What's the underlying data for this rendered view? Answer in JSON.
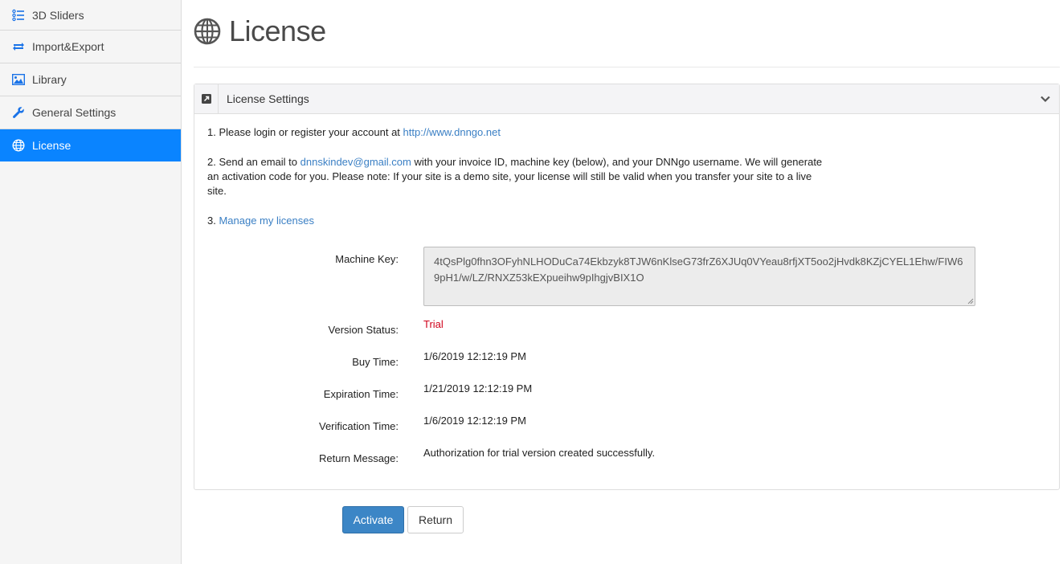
{
  "sidebar": {
    "items": [
      {
        "label": "3D Sliders",
        "icon": "list-icon"
      },
      {
        "label": "Import&Export",
        "icon": "sync-icon"
      },
      {
        "label": "Library",
        "icon": "image-icon"
      },
      {
        "label": "General Settings",
        "icon": "wrench-icon"
      },
      {
        "label": "License",
        "icon": "globe-icon",
        "active": true
      }
    ]
  },
  "header": {
    "title": "License"
  },
  "panel": {
    "title": "License Settings",
    "steps": {
      "s1_prefix": "1. Please login or register your account at ",
      "s1_link": "http://www.dnngo.net",
      "s2_prefix": "2. Send an email to ",
      "s2_link": "dnnskindev@gmail.com",
      "s2_suffix": " with your invoice ID, machine key (below), and your DNNgo username. We will generate an activation code for you. Please note: If your site is a demo site, your license will still be valid when you transfer your site to a live site.",
      "s3_prefix": "3. ",
      "s3_link": "Manage my licenses"
    },
    "fields": {
      "machine_key_label": "Machine Key:",
      "machine_key_value": "4tQsPlg0fhn3OFyhNLHODuCa74Ekbzyk8TJW6nKlseG73frZ6XJUq0VYeau8rfjXT5oo2jHvdk8KZjCYEL1Ehw/FIW69pH1/w/LZ/RNXZ53kEXpueihw9pIhgjvBIX1O",
      "version_status_label": "Version Status:",
      "version_status_value": "Trial",
      "buy_time_label": "Buy Time:",
      "buy_time_value": "1/6/2019 12:12:19 PM",
      "expiration_time_label": "Expiration Time:",
      "expiration_time_value": "1/21/2019 12:12:19 PM",
      "verification_time_label": "Verification Time:",
      "verification_time_value": "1/6/2019 12:12:19 PM",
      "return_message_label": "Return Message:",
      "return_message_value": "Authorization for trial version created successfully."
    }
  },
  "buttons": {
    "activate": "Activate",
    "return": "Return"
  },
  "colors": {
    "active_nav": "#0a84ff",
    "primary_button": "#3c86c6",
    "link": "#3a7fc4",
    "trial": "#d0021b"
  }
}
